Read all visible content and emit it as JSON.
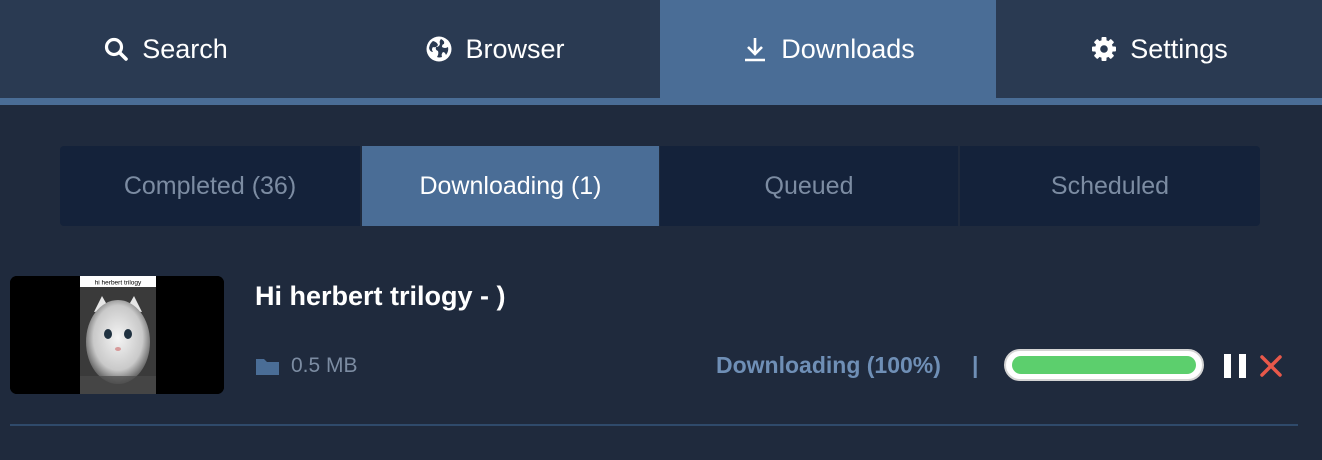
{
  "nav": {
    "tabs": [
      {
        "label": "Search",
        "icon": "search-icon"
      },
      {
        "label": "Browser",
        "icon": "globe-icon"
      },
      {
        "label": "Downloads",
        "icon": "download-icon",
        "active": true
      },
      {
        "label": "Settings",
        "icon": "gear-icon"
      }
    ]
  },
  "subtabs": [
    {
      "label": "Completed (36)"
    },
    {
      "label": "Downloading (1)",
      "active": true
    },
    {
      "label": "Queued"
    },
    {
      "label": "Scheduled"
    }
  ],
  "download": {
    "thumbnail_caption": "hi herbert trilogy",
    "title": "Hi herbert trilogy - )",
    "size": "0.5 MB",
    "status": "Downloading (100%)",
    "separator": "|",
    "progress": 1.0
  },
  "colors": {
    "background": "#1f2a3d",
    "nav": "#2a3a52",
    "accent": "#4a6d96",
    "progress": "#5ccf6d",
    "cancel": "#e8584a"
  }
}
